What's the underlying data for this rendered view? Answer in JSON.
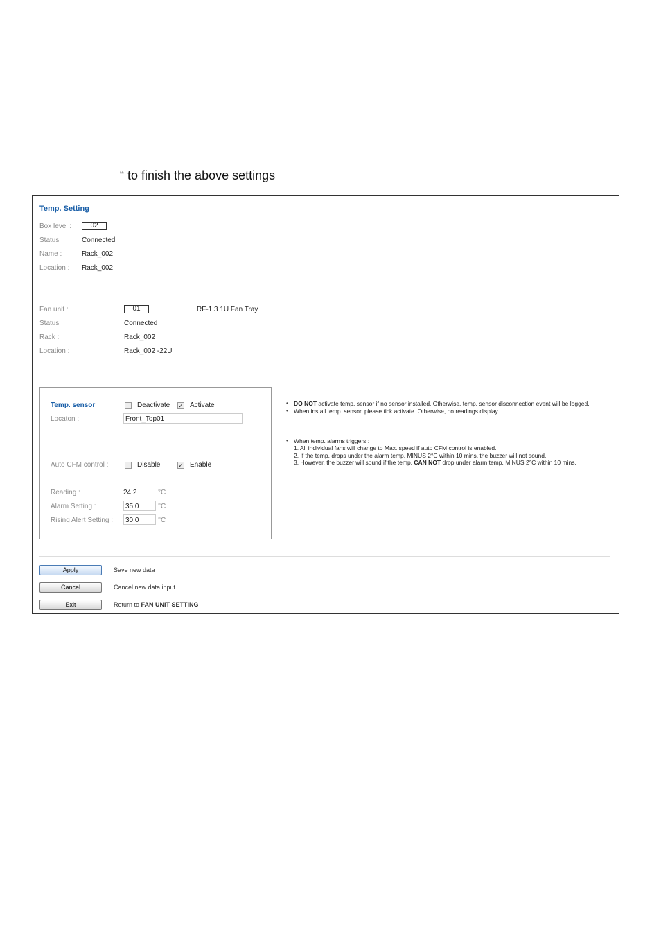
{
  "doc_text": "“ to finish the above settings",
  "page": {
    "title": "Temp.  Setting",
    "box": {
      "box_level_label": "Box level :",
      "box_level_value": "02",
      "status_label": "Status :",
      "status_value": "Connected",
      "name_label": "Name :",
      "name_value": "Rack_002",
      "location_label": "Location :",
      "location_value": "Rack_002"
    },
    "fan": {
      "fan_unit_label": "Fan unit :",
      "fan_unit_value": "01",
      "fan_model": "RF-1.3 1U Fan Tray",
      "status_label": "Status :",
      "status_value": "Connected",
      "rack_label": "Rack :",
      "rack_value": "Rack_002",
      "location_label": "Location :",
      "location_value": "Rack_002 -22U"
    },
    "sensor": {
      "title": "Temp. sensor",
      "deactivate_label": "Deactivate",
      "activate_label": "Activate",
      "deactivate_checked": false,
      "activate_checked": true,
      "location_label": "Locaton :",
      "location_value": "Front_Top01",
      "cfm_label": "Auto CFM control :",
      "disable_label": "Disable",
      "enable_label": "Enable",
      "disable_checked": false,
      "enable_checked": true,
      "reading_label": "Reading :",
      "reading_value": "24.2",
      "unit": "°C",
      "alarm_label": "Alarm Setting :",
      "alarm_value": "35.0",
      "rising_label": "Rising Alert Setting :",
      "rising_value": "30.0"
    },
    "notes": {
      "n1_bold": "DO NOT",
      "n1_rest": " activate temp. sensor if no sensor installed. Otherwise, temp. sensor disconnection event will be logged.",
      "n2": "When install temp. sensor, please tick activate. Otherwise, no readings display.",
      "n3": "When temp. alarms triggers :",
      "n3_1": "1. All individual fans will change to Max. speed if auto CFM control is enabled.",
      "n3_2": "2. If the temp. drops under the alarm temp. MINUS 2°C within 10 mins, the buzzer will not sound.",
      "n3_3a": "3. However, the buzzer will sound if the temp. ",
      "n3_3b": "CAN NOT",
      "n3_3c": " drop under alarm temp. MINUS 2°C within 10 mins."
    },
    "buttons": {
      "apply_label": "Apply",
      "apply_desc": "Save new data",
      "cancel_label": "Cancel",
      "cancel_desc": "Cancel new data input",
      "exit_label": "Exit",
      "exit_desc_prefix": "Return to ",
      "exit_desc_bold": "FAN UNIT SETTING"
    }
  }
}
